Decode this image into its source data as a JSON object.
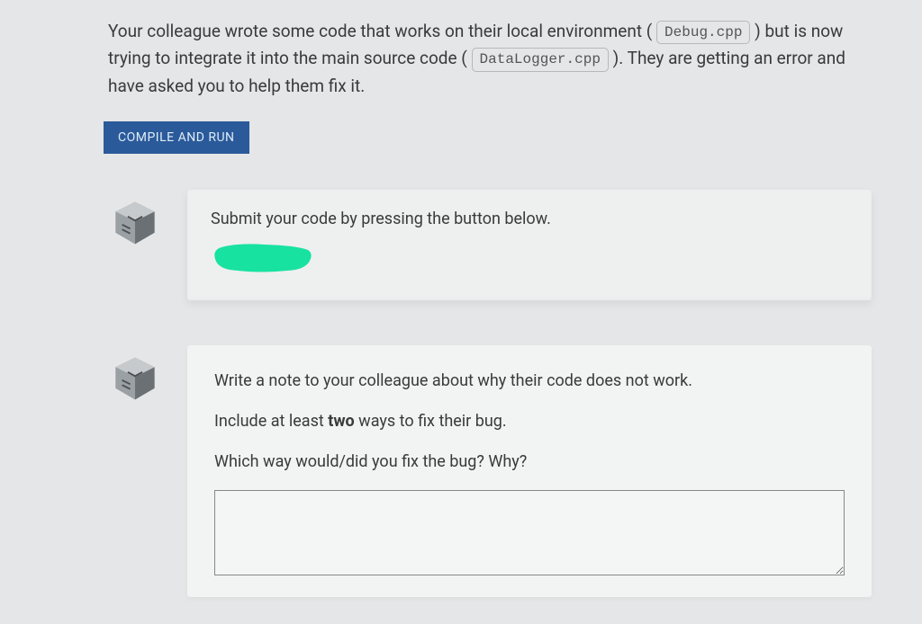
{
  "intro": {
    "seg1": "Your colleague wrote some code that works on their local environment (",
    "code1": "Debug.cpp",
    "seg2": ") but is now trying to integrate it into the main source code (",
    "code2": "DataLogger.cpp",
    "seg3": "). They are getting an error and have asked you to help them fix it."
  },
  "compile_button_label": "COMPILE AND RUN",
  "submit_card": {
    "text": "Submit your code by pressing the button below."
  },
  "note_card": {
    "line1": "Write a note to your colleague about why their code does not work.",
    "line2_pre": "Include at least ",
    "line2_bold": "two",
    "line2_post": " ways to fix their bug.",
    "line3": "Which way would/did you fix the bug? Why?",
    "textarea_value": ""
  }
}
